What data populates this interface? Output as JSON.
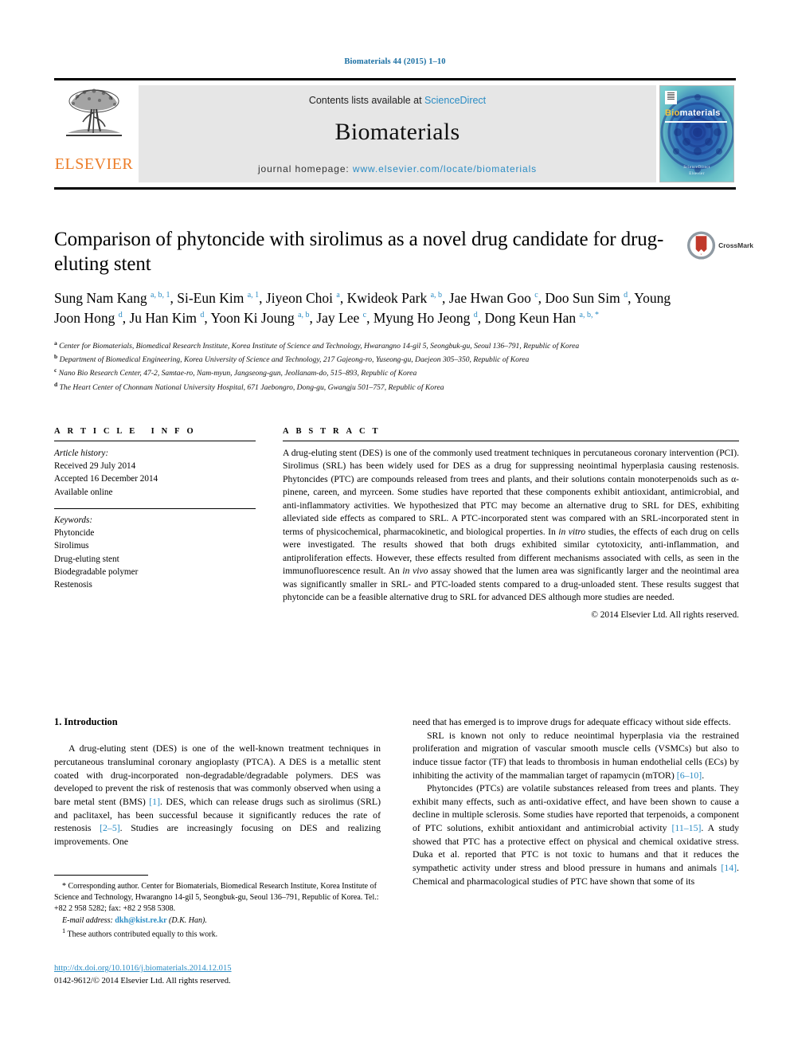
{
  "running_head": "Biomaterials 44 (2015) 1–10",
  "masthead": {
    "contents_prefix": "Contents lists available at ",
    "contents_link": "ScienceDirect",
    "journal_name": "Biomaterials",
    "homepage_prefix": "journal homepage: ",
    "homepage_url": "www.elsevier.com/locate/biomaterials",
    "publisher": "ELSEVIER",
    "cover": {
      "title_first": "Bio",
      "title_rest": "materials",
      "footer_line1": "ScienceDirect",
      "footer_line2": "Elsevier"
    }
  },
  "article": {
    "title": "Comparison of phytoncide with sirolimus as a novel drug candidate for drug-eluting stent",
    "crossmark_label": "CrossMark",
    "authors": [
      {
        "name": "Sung Nam Kang",
        "marks": "a, b, 1",
        "sep": ", "
      },
      {
        "name": "Si-Eun Kim",
        "marks": "a, 1",
        "sep": ", "
      },
      {
        "name": "Jiyeon Choi",
        "marks": "a",
        "sep": ", "
      },
      {
        "name": "Kwideok Park",
        "marks": "a, b",
        "sep": ", "
      },
      {
        "name": "Jae Hwan Goo",
        "marks": "c",
        "sep": ", "
      },
      {
        "name": "Doo Sun Sim",
        "marks": "d",
        "sep": ", "
      },
      {
        "name": "Young Joon Hong",
        "marks": "d",
        "sep": ", "
      },
      {
        "name": "Ju Han Kim",
        "marks": "d",
        "sep": ", "
      },
      {
        "name": "Yoon Ki Joung",
        "marks": "a, b",
        "sep": ", "
      },
      {
        "name": "Jay Lee",
        "marks": "c",
        "sep": ", "
      },
      {
        "name": "Myung Ho Jeong",
        "marks": "d",
        "sep": ", "
      },
      {
        "name": "Dong Keun Han",
        "marks": "a, b, *",
        "sep": ""
      }
    ],
    "affiliations": [
      {
        "mark": "a",
        "text": "Center for Biomaterials, Biomedical Research Institute, Korea Institute of Science and Technology, Hwarangno 14-gil 5, Seongbuk-gu, Seoul 136–791, Republic of Korea"
      },
      {
        "mark": "b",
        "text": "Department of Biomedical Engineering, Korea University of Science and Technology, 217 Gajeong-ro, Yuseong-gu, Daejeon 305–350, Republic of Korea"
      },
      {
        "mark": "c",
        "text": "Nano Bio Research Center, 47-2, Samtae-ro, Nam-myun, Jangseong-gun, Jeollanam-do, 515–893, Republic of Korea"
      },
      {
        "mark": "d",
        "text": "The Heart Center of Chonnam National University Hospital, 671 Jaebongro, Dong-gu, Gwangju 501–757, Republic of Korea"
      }
    ]
  },
  "article_info": {
    "heading": "ARTICLE INFO",
    "history_label": "Article history:",
    "history": [
      "Received 29 July 2014",
      "Accepted 16 December 2014",
      "Available online"
    ],
    "keywords_label": "Keywords:",
    "keywords": [
      "Phytoncide",
      "Sirolimus",
      "Drug-eluting stent",
      "Biodegradable polymer",
      "Restenosis"
    ]
  },
  "abstract": {
    "heading": "ABSTRACT",
    "paragraph_1": "A drug-eluting stent (DES) is one of the commonly used treatment techniques in percutaneous coronary intervention (PCI). Sirolimus (SRL) has been widely used for DES as a drug for suppressing neointimal hyperplasia causing restenosis. Phytoncides (PTC) are compounds released from trees and plants, and their solutions contain monoterpenoids such as α-pinene, careen, and myrceen. Some studies have reported that these components exhibit antioxidant, antimicrobial, and anti-inflammatory activities. We hypothesized that PTC may become an alternative drug to SRL for DES, exhibiting alleviated side effects as compared to SRL. A PTC-incorporated stent was compared with an SRL-incorporated stent in terms of physicochemical, pharmacokinetic, and biological properties. In ",
    "italic_1": "in vitro",
    "paragraph_2": " studies, the effects of each drug on cells were investigated. The results showed that both drugs exhibited similar cytotoxicity, anti-inflammation, and antiproliferation effects. However, these effects resulted from different mechanisms associated with cells, as seen in the immunofluorescence result. An ",
    "italic_2": "in vivo",
    "paragraph_3": " assay showed that the lumen area was significantly larger and the neointimal area was significantly smaller in SRL- and PTC-loaded stents compared to a drug-unloaded stent. These results suggest that phytoncide can be a feasible alternative drug to SRL for advanced DES although more studies are needed.",
    "copyright": "© 2014 Elsevier Ltd. All rights reserved."
  },
  "body": {
    "section_heading": "1. Introduction",
    "left_paragraph_1a": "A drug-eluting stent (DES) is one of the well-known treatment techniques in percutaneous transluminal coronary angioplasty (PTCA). A DES is a metallic stent coated with drug-incorporated non-degradable/degradable polymers. DES was developed to prevent the risk of restenosis that was commonly observed when using a bare metal stent (BMS) ",
    "left_ref_1": "[1]",
    "left_paragraph_1b": ". DES, which can release drugs such as sirolimus (SRL) and paclitaxel, has been successful because it significantly reduces the rate of restenosis ",
    "left_ref_2": "[2–5]",
    "left_paragraph_1c": ". Studies are increasingly focusing on DES and realizing improvements. One",
    "right_paragraph_1": "need that has emerged is to improve drugs for adequate efficacy without side effects.",
    "right_paragraph_2a": "SRL is known not only to reduce neointimal hyperplasia via the restrained proliferation and migration of vascular smooth muscle cells (VSMCs) but also to induce tissue factor (TF) that leads to thrombosis in human endothelial cells (ECs) by inhibiting the activity of the mammalian target of rapamycin (mTOR) ",
    "right_ref_1": "[6–10]",
    "right_paragraph_2b": ".",
    "right_paragraph_3a": "Phytoncides (PTCs) are volatile substances released from trees and plants. They exhibit many effects, such as anti-oxidative effect, and have been shown to cause a decline in multiple sclerosis. Some studies have reported that terpenoids, a component of PTC solutions, exhibit antioxidant and antimicrobial activity ",
    "right_ref_2": "[11–15]",
    "right_paragraph_3b": ". A study showed that PTC has a protective effect on physical and chemical oxidative stress. Duka et al. reported that PTC is not toxic to humans and that it reduces the sympathetic activity under stress and blood pressure in humans and animals ",
    "right_ref_3": "[14]",
    "right_paragraph_3c": ". Chemical and pharmacological studies of PTC have shown that some of its"
  },
  "footnotes": {
    "corresponding": "* Corresponding author. Center for Biomaterials, Biomedical Research Institute, Korea Institute of Science and Technology, Hwarangno 14-gil 5, Seongbuk-gu, Seoul 136–791, Republic of Korea. Tel.: +82 2 958 5282; fax: +82 2 958 5308.",
    "email_label": "E-mail address:",
    "email": "dkh@kist.re.kr",
    "email_suffix": "(D.K. Han).",
    "equal_contrib_mark": "1",
    "equal_contrib": "These authors contributed equally to this work."
  },
  "footer": {
    "doi": "http://dx.doi.org/10.1016/j.biomaterials.2014.12.015",
    "issn": "0142-9612/© 2014 Elsevier Ltd. All rights reserved."
  }
}
